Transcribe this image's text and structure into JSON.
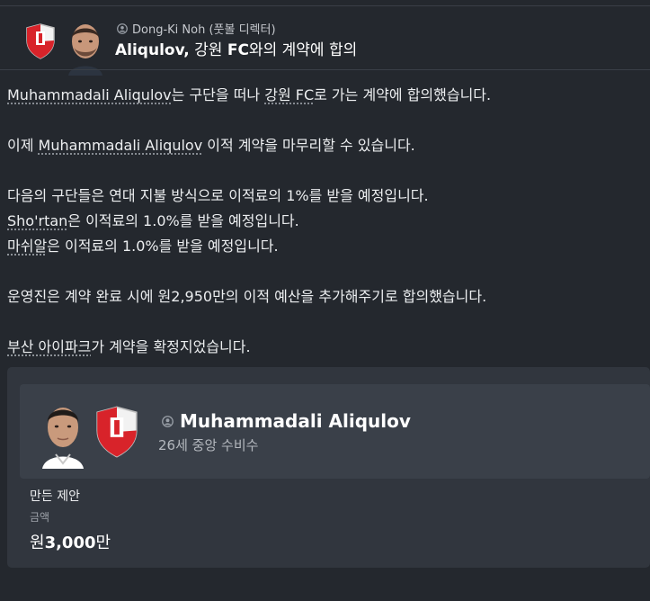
{
  "header": {
    "sender": "Dong-Ki Noh (풋볼 디렉터)",
    "subject_player": "Aliqulov,",
    "subject_pre": " 강원 ",
    "subject_fc": "FC",
    "subject_post": "와의 계약에 합의"
  },
  "body": {
    "line1": {
      "player": "Muhammadali Aliqulov",
      "mid": "는 구단을 떠나 ",
      "club": "강원 FC",
      "end": "로 가는 계약에 합의했습니다."
    },
    "line2": {
      "pre": "이제 ",
      "player": "Muhammadali Aliqulov",
      "end": " 이적 계약을 마무리할 수 있습니다."
    },
    "line3": "다음의 구단들은 연대 지불 방식으로 이적료의 1%를 받을 예정입니다.",
    "line4": {
      "club": "Sho'rtan",
      "end": "은 이적료의 1.0%를 받을 예정입니다."
    },
    "line5": {
      "club": "마쉬알",
      "end": "은 이적료의 1.0%를 받을 예정입니다."
    },
    "line6": "운영진은 계약 완료 시에 원2,950만의 이적 예산을 추가해주기로 합의했습니다.",
    "line7": {
      "club": "부산 아이파크",
      "end": "가 계약을 확정지었습니다."
    }
  },
  "card": {
    "player_name": "Muhammadali Aliqulov",
    "player_meta": "26세 중앙 수비수",
    "offer_label": "만든 제안",
    "amount_label": "금액",
    "amount_prefix": "원",
    "amount_value": "3,000",
    "amount_suffix": "만"
  },
  "colors": {
    "background": "#24282e",
    "card": "#31363e",
    "card_inner": "#3a4049",
    "crest_red": "#d8232a"
  }
}
